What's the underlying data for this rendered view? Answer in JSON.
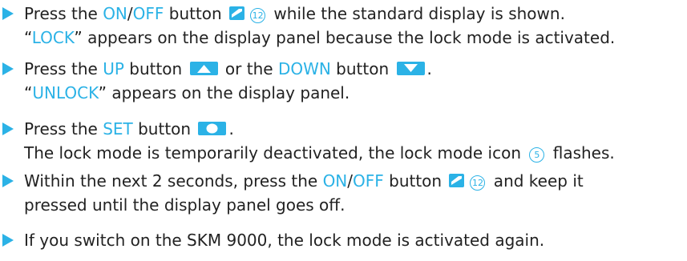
{
  "colors": {
    "accent": "#2bb2e6",
    "text": "#222222"
  },
  "steps": [
    {
      "l1a": "Press the ",
      "on": "ON",
      "sep": "/",
      "off": "OFF",
      "l1b": " button ",
      "num": "12",
      "l1c": " while the standard display is shown.",
      "l2a": "“",
      "lock": "LOCK",
      "l2b": "” appears on the display panel because the lock mode is activated."
    },
    {
      "l1a": "Press the ",
      "up": "UP",
      "l1b": " button ",
      "l1c": " or the ",
      "down": "DOWN",
      "l1d": " button ",
      "l1e": ".",
      "l2a": "“",
      "unlock": "UNLOCK",
      "l2b": "” appears on the display panel."
    },
    {
      "l1a": "Press the ",
      "set": "SET",
      "l1b": " button ",
      "l1c": ".",
      "l2a": "The lock mode is temporarily deactivated, the lock mode icon ",
      "num": "5",
      "l2b": " flashes."
    },
    {
      "l1a": "Within the next 2 seconds, press the ",
      "on": "ON",
      "sep": "/",
      "off": "OFF",
      "l1b": " button ",
      "num": "12",
      "l1c": " and keep it",
      "l2a": "pressed until the display panel goes off."
    },
    {
      "l1a": "If you switch on the SKM 9000, the lock mode is activated again."
    }
  ]
}
